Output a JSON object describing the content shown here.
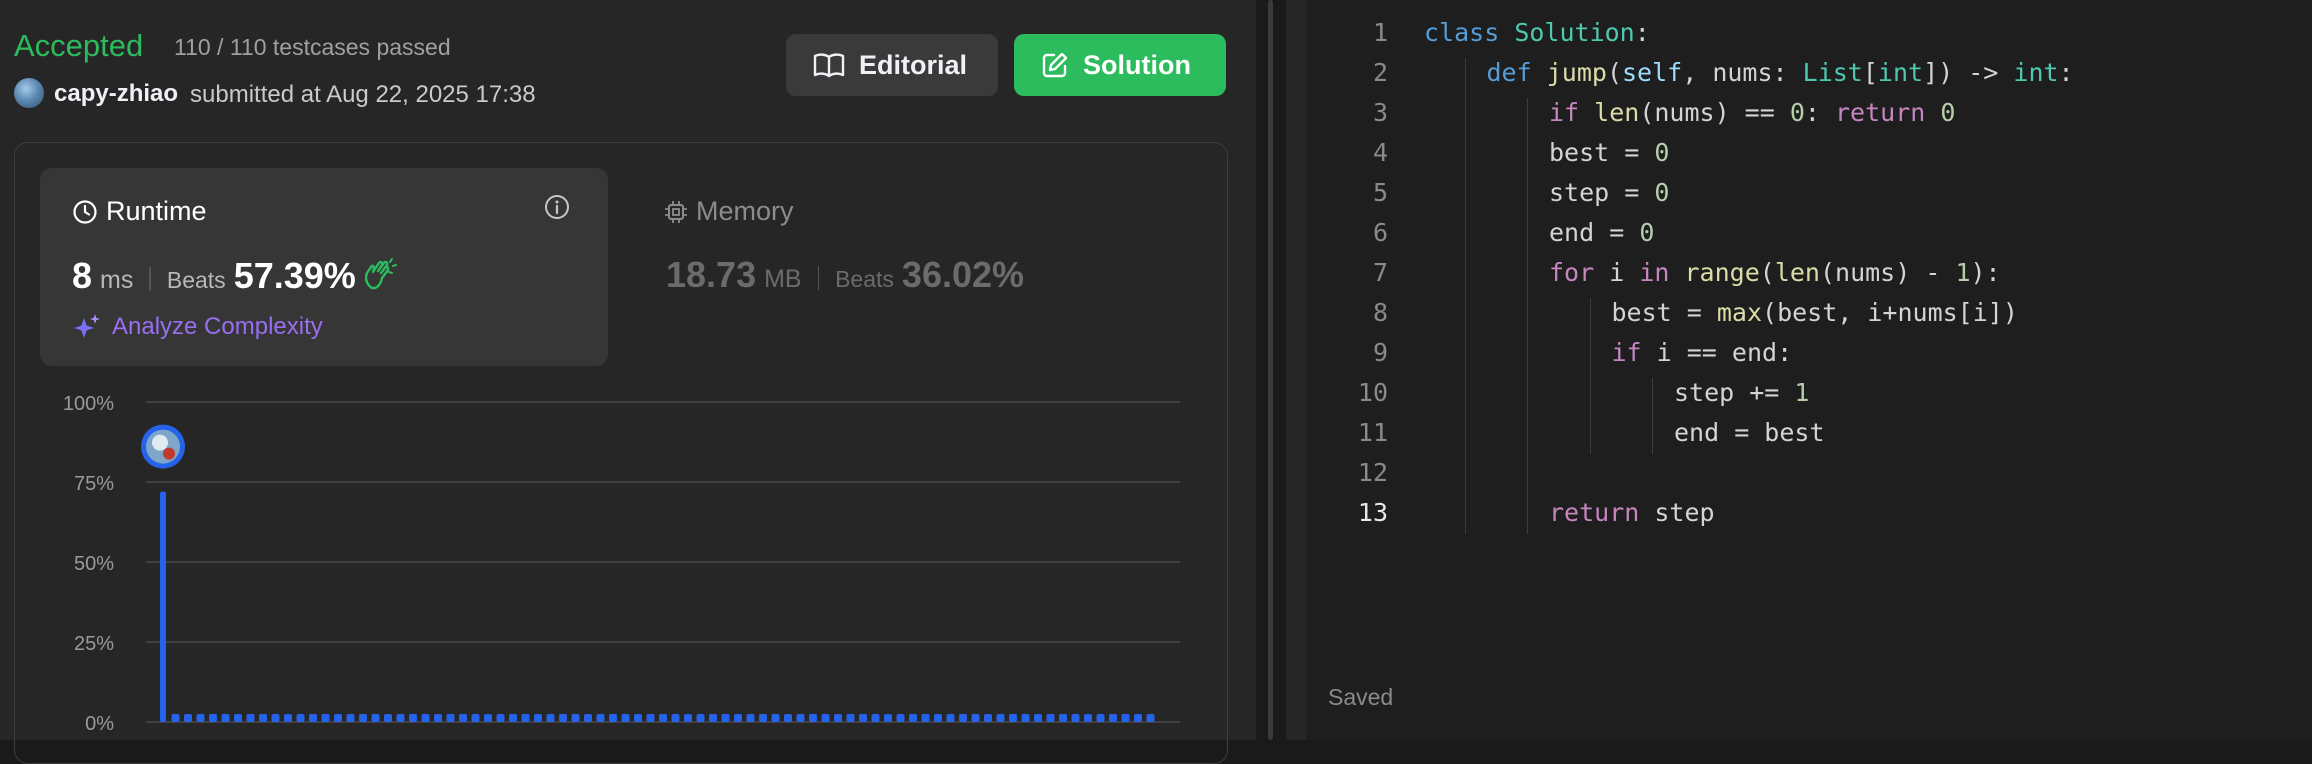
{
  "result": {
    "status": "Accepted",
    "testcases": "110 / 110 testcases passed",
    "username": "capy-zhiao",
    "submitted": "submitted at Aug 22, 2025 17:38"
  },
  "buttons": {
    "editorial": "Editorial",
    "solution": "Solution"
  },
  "runtime": {
    "title": "Runtime",
    "value": "8",
    "unit": "ms",
    "beats_label": "Beats",
    "beats": "57.39%",
    "analyze": "Analyze Complexity"
  },
  "memory": {
    "title": "Memory",
    "value": "18.73",
    "unit": "MB",
    "beats_label": "Beats",
    "beats": "36.02%"
  },
  "colors": {
    "accepted": "#2cbb5d",
    "accent_purple": "#9a6ef2",
    "bar_blue": "#2563eb"
  },
  "chart_data": {
    "type": "bar",
    "y_ticks": [
      "100%",
      "75%",
      "50%",
      "25%",
      "0%"
    ],
    "ylim": [
      0,
      100
    ],
    "x_tick_labels": [
      "",
      "",
      "",
      "",
      "",
      "",
      "",
      ""
    ],
    "values": [
      72,
      2.5,
      2.5,
      2.5,
      2.5,
      2.5,
      2.5,
      2.5,
      2.5,
      2.5,
      2.5,
      2.5,
      2.5,
      2.5,
      2.5,
      2.5,
      2.5,
      2.5,
      2.5,
      2.5,
      2.5,
      2.5,
      2.5,
      2.5,
      2.5,
      2.5,
      2.5,
      2.5,
      2.5,
      2.5,
      2.5,
      2.5,
      2.5,
      2.5,
      2.5,
      2.5,
      2.5,
      2.5,
      2.5,
      2.5,
      2.5,
      2.5,
      2.5,
      2.5,
      2.5,
      2.5,
      2.5,
      2.5,
      2.5,
      2.5,
      2.5,
      2.5,
      2.5,
      2.5,
      2.5,
      2.5,
      2.5,
      2.5,
      2.5,
      2.5,
      2.5,
      2.5,
      2.5,
      2.5,
      2.5,
      2.5,
      2.5,
      2.5,
      2.5,
      2.5,
      2.5,
      2.5,
      2.5,
      2.5,
      2.5,
      2.5,
      2.5,
      2.5,
      2.5,
      2.5
    ],
    "marker_bar": 0,
    "grid": true
  },
  "editor": {
    "lines": [
      {
        "n": "1",
        "indent": 0,
        "tokens": [
          [
            "class ",
            "kw2"
          ],
          [
            "Solution",
            "cls"
          ],
          [
            ":",
            ""
          ]
        ]
      },
      {
        "n": "2",
        "indent": 1,
        "tokens": [
          [
            "def ",
            "kw2"
          ],
          [
            "jump",
            "fn"
          ],
          [
            "(",
            ""
          ],
          [
            "self",
            "slf"
          ],
          [
            ", nums: ",
            ""
          ],
          [
            "List",
            "cls"
          ],
          [
            "[",
            ""
          ],
          [
            "int",
            "cls"
          ],
          [
            "]) -> ",
            ""
          ],
          [
            "int",
            "cls"
          ],
          [
            ":",
            ""
          ]
        ]
      },
      {
        "n": "3",
        "indent": 2,
        "tokens": [
          [
            "if ",
            "kw"
          ],
          [
            "len",
            "fn"
          ],
          [
            "(nums) == ",
            ""
          ],
          [
            "0",
            "num"
          ],
          [
            ": ",
            ""
          ],
          [
            "return ",
            "kw"
          ],
          [
            "0",
            "num"
          ]
        ]
      },
      {
        "n": "4",
        "indent": 2,
        "tokens": [
          [
            "best = ",
            ""
          ],
          [
            "0",
            "num"
          ]
        ]
      },
      {
        "n": "5",
        "indent": 2,
        "tokens": [
          [
            "step = ",
            ""
          ],
          [
            "0",
            "num"
          ]
        ]
      },
      {
        "n": "6",
        "indent": 2,
        "tokens": [
          [
            "end = ",
            ""
          ],
          [
            "0",
            "num"
          ]
        ]
      },
      {
        "n": "7",
        "indent": 2,
        "tokens": [
          [
            "for ",
            "kw"
          ],
          [
            "i ",
            ""
          ],
          [
            "in ",
            "kw"
          ],
          [
            "range",
            "fn"
          ],
          [
            "(",
            ""
          ],
          [
            "len",
            "fn"
          ],
          [
            "(nums) - ",
            ""
          ],
          [
            "1",
            "num"
          ],
          [
            "):",
            ""
          ]
        ]
      },
      {
        "n": "8",
        "indent": 3,
        "tokens": [
          [
            "best = ",
            ""
          ],
          [
            "max",
            "fn"
          ],
          [
            "(best, i+nums[i])",
            ""
          ]
        ]
      },
      {
        "n": "9",
        "indent": 3,
        "tokens": [
          [
            "if ",
            "kw"
          ],
          [
            "i == end:",
            ""
          ]
        ]
      },
      {
        "n": "10",
        "indent": 4,
        "tokens": [
          [
            "step += ",
            ""
          ],
          [
            "1",
            "num"
          ]
        ]
      },
      {
        "n": "11",
        "indent": 4,
        "tokens": [
          [
            "end = best",
            ""
          ]
        ]
      },
      {
        "n": "12",
        "indent": 0,
        "tokens": []
      },
      {
        "n": "13",
        "indent": 2,
        "tokens": [
          [
            "return ",
            "kw"
          ],
          [
            "step",
            ""
          ]
        ]
      }
    ],
    "active_line": "13",
    "status": "Saved"
  }
}
